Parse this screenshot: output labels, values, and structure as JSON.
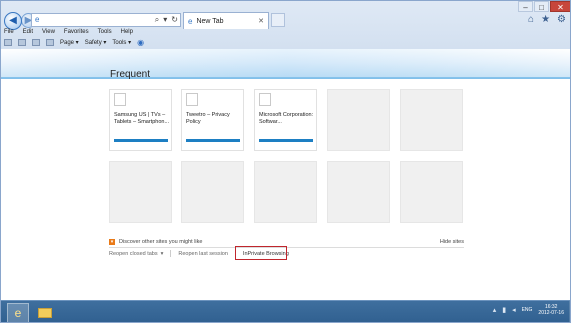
{
  "browser": {
    "address": {
      "value": "",
      "placeholder": ""
    },
    "tab": {
      "label": "New Tab"
    },
    "window_controls": {
      "minimize": "–",
      "maximize": "□",
      "close": "✕"
    },
    "menu": [
      "File",
      "Edit",
      "View",
      "Favorites",
      "Tools",
      "Help"
    ],
    "command_bar": {
      "page": "Page ▾",
      "safety": "Safety ▾",
      "tools": "Tools ▾"
    }
  },
  "new_tab_page": {
    "heading": "Frequent",
    "tiles": [
      {
        "title": "Samsung US | TVs – Tablets – Smartphon..."
      },
      {
        "title": "Tweetro – Privacy Policy"
      },
      {
        "title": "Microsoft Corporation: Softwar..."
      },
      {
        "title": ""
      },
      {
        "title": ""
      },
      {
        "title": ""
      },
      {
        "title": ""
      },
      {
        "title": ""
      },
      {
        "title": ""
      },
      {
        "title": ""
      }
    ],
    "discover_text": "Discover other sites you might like",
    "hide_sites": "Hide sites",
    "reopen_closed_tabs": "Reopen closed tabs",
    "reopen_last_session": "Reopen last session",
    "inprivate": "InPrivate Browsing"
  },
  "taskbar": {
    "language": "ENG",
    "time": "16:32",
    "date": "2012-07-16"
  },
  "colors": {
    "accent_blue": "#1d7fc3",
    "highlight_red": "#c0262d",
    "taskbar": "#3a6a99"
  }
}
